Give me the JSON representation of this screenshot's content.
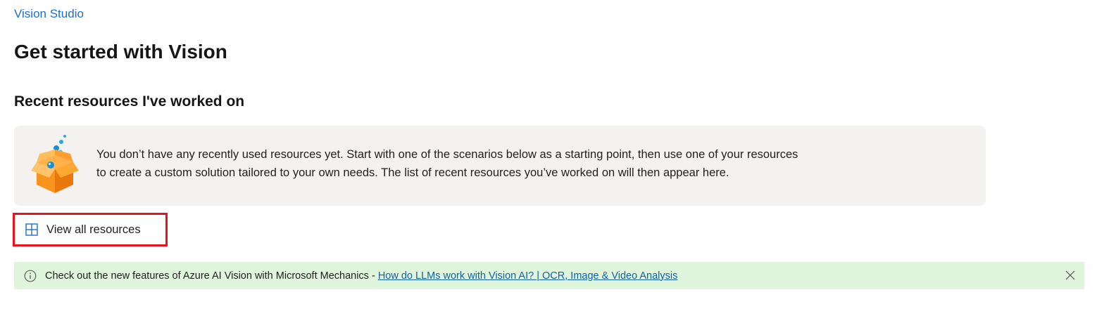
{
  "breadcrumb": {
    "label": "Vision Studio"
  },
  "header": {
    "title": "Get started with Vision"
  },
  "recent": {
    "heading": "Recent resources I've worked on",
    "empty_message_line1": "You don’t have any recently used resources yet. Start with one of the scenarios below as a starting point, then use one of your resources",
    "empty_message_line2": "to create a custom solution tailored to your own needs. The list of recent resources you’ve worked on will then appear here.",
    "illustration_icon": "open-box-icon"
  },
  "view_all": {
    "label": "View all resources",
    "icon": "grid-icon",
    "highlight_color": "#e8131b"
  },
  "banner": {
    "text": "Check out the new features of Azure AI Vision with Microsoft Mechanics - ",
    "link_text": "How do LLMs work with Vision AI? | OCR, Image & Video Analysis",
    "icon": "info-icon",
    "close_icon": "close-icon",
    "background_color": "#dff6dd"
  },
  "colors": {
    "link": "#1f6fc5",
    "accent": "#0078d4"
  }
}
